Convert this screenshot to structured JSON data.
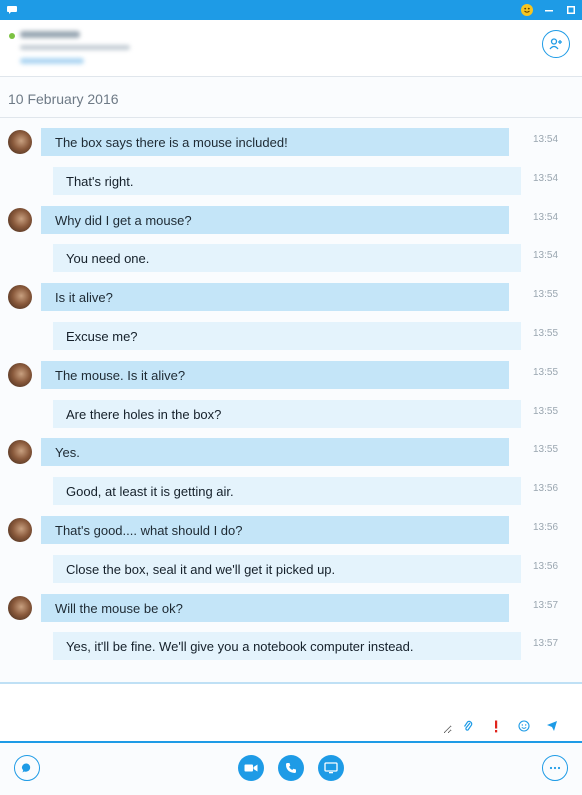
{
  "colors": {
    "accent": "#1e9be6",
    "incoming_bubble": "#c4e5f8",
    "outgoing_bubble": "#e4f3fc",
    "timestamp": "#9aa6b0",
    "alert": "#e0241c"
  },
  "titlebar": {
    "icons": [
      "chat-icon",
      "emoticon-icon",
      "minimize-icon",
      "maximize-icon"
    ]
  },
  "header": {
    "icons": [
      "add-contact-icon"
    ]
  },
  "conversation": {
    "date": "10 February 2016",
    "messages": [
      {
        "dir": "in",
        "text": "The box says there is a mouse included!",
        "time": "13:54"
      },
      {
        "dir": "out",
        "text": "That's right.",
        "time": "13:54"
      },
      {
        "dir": "in",
        "text": "Why did I get a mouse?",
        "time": "13:54"
      },
      {
        "dir": "out",
        "text": "You need one.",
        "time": "13:54"
      },
      {
        "dir": "in",
        "text": "Is it alive?",
        "time": "13:55"
      },
      {
        "dir": "out",
        "text": "Excuse me?",
        "time": "13:55"
      },
      {
        "dir": "in",
        "text": "The mouse. Is it alive?",
        "time": "13:55"
      },
      {
        "dir": "out",
        "text": "Are there holes in the box?",
        "time": "13:55"
      },
      {
        "dir": "in",
        "text": "Yes.",
        "time": "13:55"
      },
      {
        "dir": "out",
        "text": "Good, at least it is getting air.",
        "time": "13:56"
      },
      {
        "dir": "in",
        "text": "That's good.... what should I do?",
        "time": "13:56"
      },
      {
        "dir": "out",
        "text": "Close the box, seal it and we'll get it picked up.",
        "time": "13:56"
      },
      {
        "dir": "in",
        "text": "Will the mouse be ok?",
        "time": "13:57"
      },
      {
        "dir": "out",
        "text": "Yes, it'll be fine. We'll give you a notebook computer instead.",
        "time": "13:57"
      }
    ]
  },
  "compose": {
    "placeholder": "",
    "icons": [
      "attach-icon",
      "important-icon",
      "emoticon-icon",
      "send-icon"
    ]
  },
  "bottombar": {
    "icons": [
      "chat-icon",
      "video-call-icon",
      "audio-call-icon",
      "screen-share-icon",
      "more-options-icon"
    ]
  }
}
